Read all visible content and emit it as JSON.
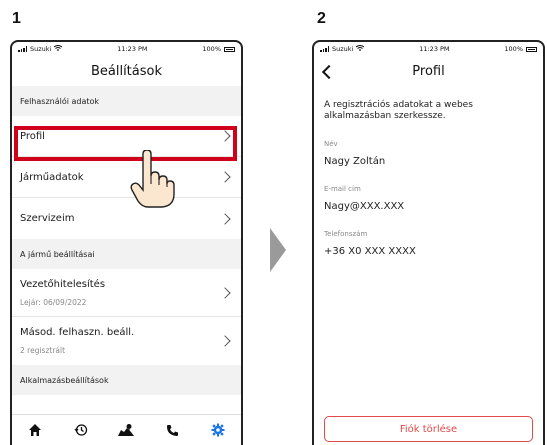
{
  "steps": [
    "1",
    "2"
  ],
  "statusbar": {
    "carrier": "Suzuki",
    "time": "11:23 PM",
    "battery": "100%"
  },
  "screen1": {
    "title": "Beállítások",
    "sections": [
      {
        "header": "Felhasználói adatok"
      },
      {
        "header": "A jármű beállításai"
      },
      {
        "header": "Alkalmazásbeállítások"
      }
    ],
    "rows": [
      {
        "label": "Profil"
      },
      {
        "label": "Járműadatok"
      },
      {
        "label": "Szervizeim"
      },
      {
        "label": "Vezetőhitelesítés",
        "sub": "Lejár: 06/09/2022"
      },
      {
        "label": "Másod. felhaszn. beáll.",
        "sub": "2 regisztrált"
      }
    ],
    "tabs": [
      "home-icon",
      "history-icon",
      "map-icon",
      "phone-icon",
      "gear-icon"
    ],
    "accent": "#1a73e8",
    "highlight_color": "#d0021b"
  },
  "screen2": {
    "title": "Profil",
    "intro": "A regisztrációs adatokat a webes alkalmazásban szerkessze.",
    "fields": [
      {
        "label": "Név",
        "value": "Nagy Zoltán"
      },
      {
        "label": "E-mail cím",
        "value": "Nagy@XXX.XXX"
      },
      {
        "label": "Telefonszám",
        "value": "+36 X0 XXX XXXX"
      }
    ],
    "delete_button": "Fiók törlése",
    "danger_color": "#e04a4a"
  }
}
